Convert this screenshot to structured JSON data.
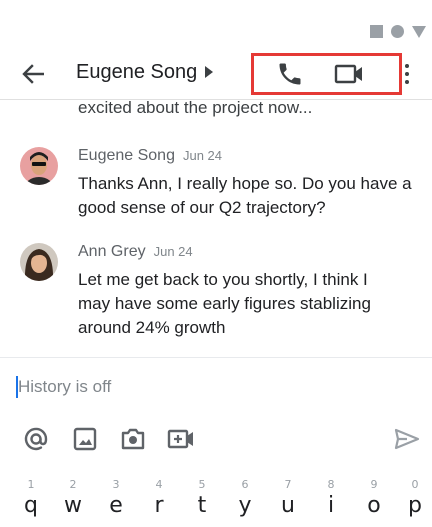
{
  "status_bar": {
    "icons": [
      "square-icon",
      "circle-icon",
      "triangle-icon"
    ]
  },
  "header": {
    "title": "Eugene Song",
    "actions": [
      "phone-icon",
      "video-call-icon",
      "more-vert-icon"
    ],
    "highlight_color": "#e53935"
  },
  "conversation": {
    "partial_text": "excited about the project now...",
    "messages": [
      {
        "sender": "Eugene Song",
        "time": "Jun 24",
        "text": "Thanks Ann, I really hope so. Do you have a good sense of our Q2 trajectory?"
      },
      {
        "sender": "Ann Grey",
        "time": "Jun 24",
        "text": "Let me get back to you shortly, I think I may have some early figures stablizing around 24% growth"
      }
    ]
  },
  "compose": {
    "placeholder": "History is off"
  },
  "toolbar": {
    "icons": [
      "at-icon",
      "image-icon",
      "camera-icon",
      "video-add-icon",
      "send-icon"
    ]
  },
  "keyboard": {
    "numbers": [
      "1",
      "2",
      "3",
      "4",
      "5",
      "6",
      "7",
      "8",
      "9",
      "0"
    ],
    "letters": [
      "q",
      "w",
      "e",
      "r",
      "t",
      "y",
      "u",
      "i",
      "o",
      "p"
    ]
  }
}
